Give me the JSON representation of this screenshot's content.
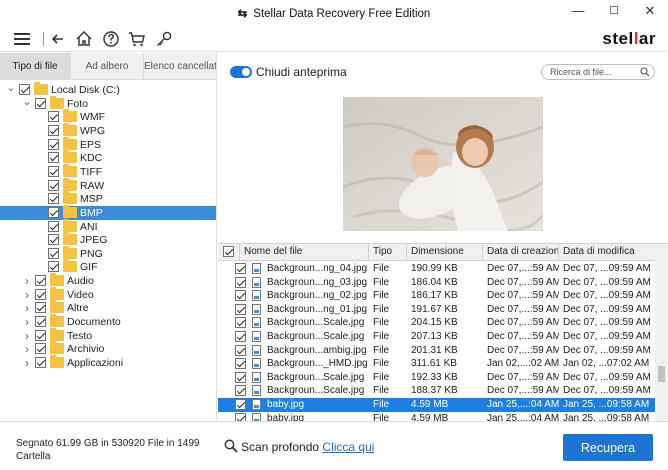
{
  "window": {
    "title": "Stellar Data Recovery Free Edition",
    "minimize": "—",
    "maximize": "☐",
    "close": "✕"
  },
  "toolbar": {
    "icons": [
      "menu-icon",
      "back-icon",
      "home-icon",
      "help-icon",
      "cart-icon",
      "key-icon"
    ],
    "brand_pre": "stel",
    "brand_i": "l",
    "brand_post": "ar"
  },
  "left_tabs": [
    "Tipo di file",
    "Ad albero",
    "Elenco cancellato"
  ],
  "tree": [
    {
      "label": "Local Disk (C:)",
      "level": 0,
      "expanded": true
    },
    {
      "label": "Foto",
      "level": 1,
      "expanded": true
    },
    {
      "label": "WMF",
      "level": 2
    },
    {
      "label": "WPG",
      "level": 2
    },
    {
      "label": "EPS",
      "level": 2
    },
    {
      "label": "KDC",
      "level": 2
    },
    {
      "label": "TIFF",
      "level": 2
    },
    {
      "label": "RAW",
      "level": 2
    },
    {
      "label": "MSP",
      "level": 2
    },
    {
      "label": "BMP",
      "level": 2,
      "selected": true
    },
    {
      "label": "ANI",
      "level": 2
    },
    {
      "label": "JPEG",
      "level": 2
    },
    {
      "label": "PNG",
      "level": 2
    },
    {
      "label": "GIF",
      "level": 2
    },
    {
      "label": "Audio",
      "level": 1,
      "expanded": false
    },
    {
      "label": "Video",
      "level": 1,
      "expanded": false
    },
    {
      "label": "Altre",
      "level": 1,
      "expanded": false
    },
    {
      "label": "Documento",
      "level": 1,
      "expanded": false
    },
    {
      "label": "Testo",
      "level": 1,
      "expanded": false
    },
    {
      "label": "Archivio",
      "level": 1,
      "expanded": false
    },
    {
      "label": "Applicazioni",
      "level": 1,
      "expanded": false
    }
  ],
  "preview": {
    "toggle_label": "Chiudi anteprima",
    "toggle_on": true,
    "search_placeholder": "Ricerca di file..."
  },
  "table": {
    "headers": [
      "Nome del file",
      "Tipo",
      "Dimensione",
      "Data di creazione",
      "Data di modifica"
    ],
    "rows": [
      [
        "Backgroun...ng_04.jpg",
        "File",
        "190.99 KB",
        "Dec 07,...:59 AM",
        "Dec 07, ...09:59 AM"
      ],
      [
        "Backgroun...ng_03.jpg",
        "File",
        "186.04 KB",
        "Dec 07,...:59 AM",
        "Dec 07, ...09:59 AM"
      ],
      [
        "Backgroun...ng_02.jpg",
        "File",
        "186.17 KB",
        "Dec 07,...:59 AM",
        "Dec 07, ...09:59 AM"
      ],
      [
        "Backgroun...ng_01.jpg",
        "File",
        "191.67 KB",
        "Dec 07,...:59 AM",
        "Dec 07, ...09:59 AM"
      ],
      [
        "Backgroun...Scale.jpg",
        "File",
        "204.15 KB",
        "Dec 07,...:59 AM",
        "Dec 07, ...09:59 AM"
      ],
      [
        "Backgroun...Scale.jpg",
        "File",
        "207.13 KB",
        "Dec 07,...:59 AM",
        "Dec 07, ...09:59 AM"
      ],
      [
        "Backgroun...ambig.jpg",
        "File",
        "201.31 KB",
        "Dec 07,...:59 AM",
        "Dec 07, ...09:59 AM"
      ],
      [
        "Backgroun..._HMD.jpg",
        "File",
        "311.61 KB",
        "Jan 02,...:02 AM",
        "Jan 02, ...07:02 AM"
      ],
      [
        "Backgroun...Scale.jpg",
        "File",
        "192.33 KB",
        "Dec 07,...:59 AM",
        "Dec 07, ...09:59 AM"
      ],
      [
        "Backgroun...Scale.jpg",
        "File",
        "188.37 KB",
        "Dec 07,...:59 AM",
        "Dec 07, ...09:59 AM"
      ],
      [
        "baby.jpg",
        "File",
        "4.59 MB",
        "Jan 25,...:04 AM",
        "Jan 25, ...09:58 AM"
      ],
      [
        "baby.jpg",
        "File",
        "4.59 MB",
        "Jan 25,...:04 AM",
        "Jan 25, ...09:58 AM"
      ]
    ],
    "selected_row": 10
  },
  "footer": {
    "status_line1": "Segnato 61.99 GB in 530920  File in 1499",
    "status_line2": "Cartella",
    "deep_scan_label": "Scan profondo",
    "deep_scan_link": "Clicca qui",
    "recover_button": "Recupera"
  },
  "colors": {
    "accent": "#1e74d2",
    "selection": "#1e7fe0",
    "folder": "#f5c242",
    "brand_red": "#e3312b"
  }
}
